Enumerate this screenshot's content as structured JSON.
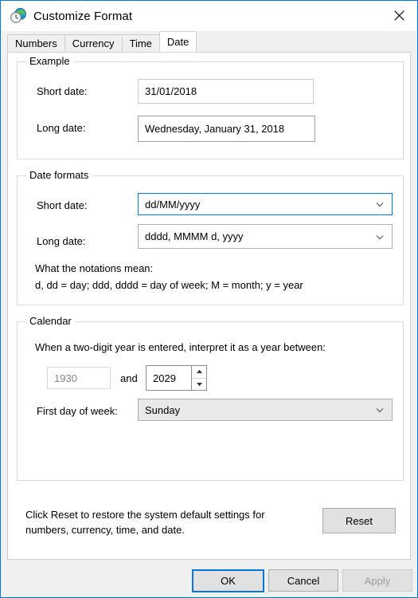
{
  "window": {
    "title": "Customize Format",
    "icon": "region-clock-globe-icon",
    "close_label": "Close"
  },
  "tabs": [
    {
      "label": "Numbers",
      "selected": false
    },
    {
      "label": "Currency",
      "selected": false
    },
    {
      "label": "Time",
      "selected": false
    },
    {
      "label": "Date",
      "selected": true
    }
  ],
  "example": {
    "legend": "Example",
    "short_date_label": "Short date:",
    "short_date_value": "31/01/2018",
    "long_date_label": "Long date:",
    "long_date_value": "Wednesday, January 31, 2018"
  },
  "date_formats": {
    "legend": "Date formats",
    "short_date_label": "Short date:",
    "short_date_value": "dd/MM/yyyy",
    "long_date_label": "Long date:",
    "long_date_value": "dddd, MMMM d, yyyy",
    "notations_title": "What the notations mean:",
    "notations_text": "d, dd = day;  ddd, dddd = day of week;  M = month;  y = year"
  },
  "calendar": {
    "legend": "Calendar",
    "two_digit_year_text": "When a two-digit year is entered, interpret it as a year between:",
    "year_from": "1930",
    "and_label": "and",
    "year_to": "2029",
    "first_day_label": "First day of week:",
    "first_day_value": "Sunday"
  },
  "reset": {
    "description": "Click Reset to restore the system default settings for numbers, currency, time, and date.",
    "button_label": "Reset"
  },
  "footer": {
    "ok_label": "OK",
    "cancel_label": "Cancel",
    "apply_label": "Apply"
  },
  "colors": {
    "accent": "#0078d7",
    "window_bg": "#f0f0f0",
    "panel_bg": "#ffffff",
    "disabled_text": "#9d9d9d"
  }
}
